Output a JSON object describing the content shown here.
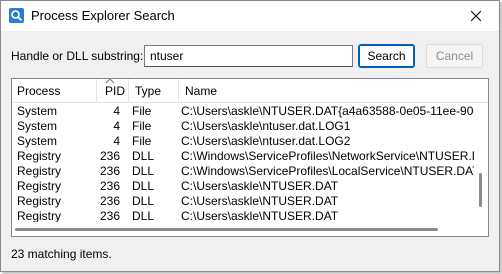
{
  "window": {
    "title": "Process Explorer Search",
    "accent_color": "#005fb8"
  },
  "search": {
    "label": "Handle or DLL substring:",
    "value": "ntuser",
    "search_button": "Search",
    "cancel_button": "Cancel"
  },
  "table": {
    "columns": [
      "Process",
      "PID",
      "Type",
      "Name"
    ],
    "sorted_column": "PID",
    "rows": [
      {
        "process": "System",
        "pid": "4",
        "type": "File",
        "name": "C:\\Users\\askle\\NTUSER.DAT{a4a63588-0e05-11ee-90de-"
      },
      {
        "process": "System",
        "pid": "4",
        "type": "File",
        "name": "C:\\Users\\askle\\ntuser.dat.LOG1"
      },
      {
        "process": "System",
        "pid": "4",
        "type": "File",
        "name": "C:\\Users\\askle\\ntuser.dat.LOG2"
      },
      {
        "process": "Registry",
        "pid": "236",
        "type": "DLL",
        "name": "C:\\Windows\\ServiceProfiles\\NetworkService\\NTUSER.DAT"
      },
      {
        "process": "Registry",
        "pid": "236",
        "type": "DLL",
        "name": "C:\\Windows\\ServiceProfiles\\LocalService\\NTUSER.DAT"
      },
      {
        "process": "Registry",
        "pid": "236",
        "type": "DLL",
        "name": "C:\\Users\\askle\\NTUSER.DAT"
      },
      {
        "process": "Registry",
        "pid": "236",
        "type": "DLL",
        "name": "C:\\Users\\askle\\NTUSER.DAT"
      },
      {
        "process": "Registry",
        "pid": "236",
        "type": "DLL",
        "name": "C:\\Users\\askle\\NTUSER.DAT"
      }
    ]
  },
  "status": {
    "text": "23 matching items."
  }
}
